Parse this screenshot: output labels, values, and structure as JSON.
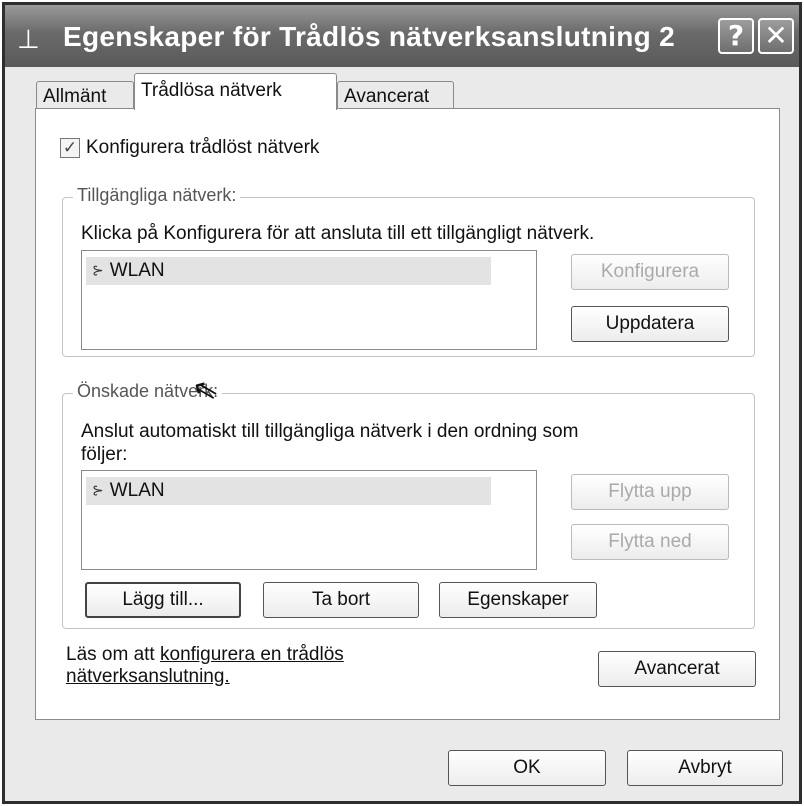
{
  "window": {
    "title": "Egenskaper för Trådlös nätverksanslutning 2",
    "help_label": "?",
    "close_label": "✕"
  },
  "tabs": [
    {
      "label": "Allmänt",
      "selected": false
    },
    {
      "label": "Trådlösa nätverk",
      "selected": true
    },
    {
      "label": "Avancerat",
      "selected": false
    }
  ],
  "config_checkbox": {
    "label": "Konfigurera trådlöst nätverk",
    "checked": true
  },
  "available": {
    "legend": "Tillgängliga nätverk:",
    "description": "Klicka på Konfigurera för att ansluta till ett tillgängligt nätverk.",
    "networks": [
      "WLAN"
    ],
    "configure_label": "Konfigurera",
    "refresh_label": "Uppdatera"
  },
  "preferred": {
    "legend": "Önskade nätverk:",
    "description_line1": "Anslut automatiskt till tillgängliga nätverk i den ordning som",
    "description_line2": "följer:",
    "networks": [
      "WLAN"
    ],
    "move_up_label": "Flytta upp",
    "move_down_label": "Flytta ned",
    "add_label": "Lägg till...",
    "remove_label": "Ta bort",
    "properties_label": "Egenskaper"
  },
  "learn_more": {
    "prefix": "Läs om att ",
    "link_line1": "konfigurera en trådlös",
    "link_line2": "nätverksanslutning."
  },
  "advanced_label": "Avancerat",
  "ok_label": "OK",
  "cancel_label": "Avbryt"
}
